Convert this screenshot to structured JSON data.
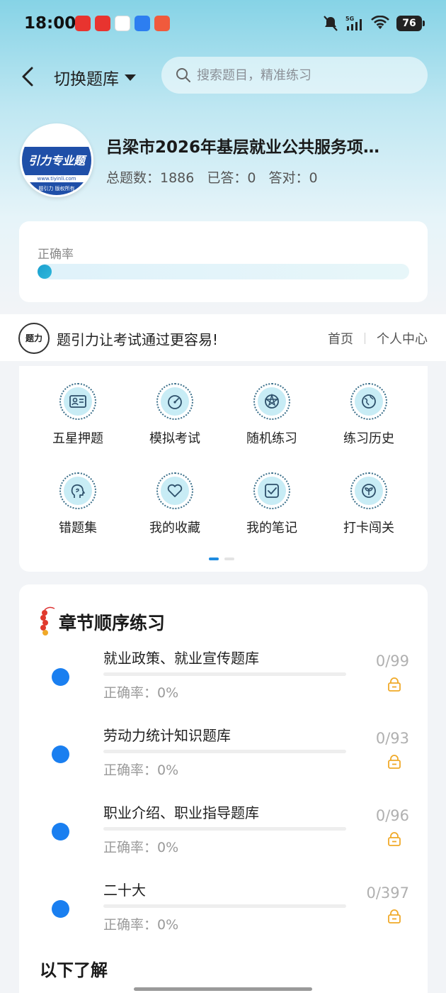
{
  "status_bar": {
    "time": "18:00",
    "battery": "76",
    "network": "5G",
    "icons": [
      "silent-icon",
      "signal-icon",
      "wifi-icon",
      "battery-icon"
    ]
  },
  "header": {
    "title": "切换题库",
    "search_placeholder": "搜索题目，精准练习"
  },
  "bank": {
    "title": "吕梁市2026年基层就业公共服务项…",
    "total": "总题数：1886",
    "answered": "已答：0",
    "correct": "答对：0",
    "logo_text": "引力专业题",
    "logo_url": "www.tiyinli.com",
    "logo_footer": "题引力 版权所有"
  },
  "accuracy": {
    "label": "正确率",
    "value": 0
  },
  "brand": {
    "slogan": "题引力让考试通过更容易!",
    "links": [
      "首页",
      "个人中心"
    ]
  },
  "grid": {
    "items": [
      {
        "label": "五星押题",
        "icon": "id-card-icon"
      },
      {
        "label": "模拟考试",
        "icon": "speedometer-icon"
      },
      {
        "label": "随机练习",
        "icon": "network-icon"
      },
      {
        "label": "练习历史",
        "icon": "globe-icon"
      },
      {
        "label": "错题集",
        "icon": "head-icon"
      },
      {
        "label": "我的收藏",
        "icon": "heart-icon"
      },
      {
        "label": "我的笔记",
        "icon": "note-check-icon"
      },
      {
        "label": "打卡闯关",
        "icon": "sprout-icon"
      }
    ],
    "page_indicator": {
      "pages": 2,
      "active": 0
    }
  },
  "chapters": {
    "title": "章节顺序练习",
    "items": [
      {
        "name": "就业政策、就业宣传题库",
        "rate": "正确率：0%",
        "count": "0/99",
        "locked": true
      },
      {
        "name": "劳动力统计知识题库",
        "rate": "正确率：0%",
        "count": "0/93",
        "locked": true
      },
      {
        "name": "职业介绍、职业指导题库",
        "rate": "正确率：0%",
        "count": "0/96",
        "locked": true
      },
      {
        "name": "二十大",
        "rate": "正确率：0%",
        "count": "0/397",
        "locked": true
      }
    ]
  },
  "section2": {
    "title": "以下了解"
  },
  "colors": {
    "accent": "#1a7ff0",
    "lock": "#f0a928",
    "icon_bg": "#c8ecf5"
  }
}
